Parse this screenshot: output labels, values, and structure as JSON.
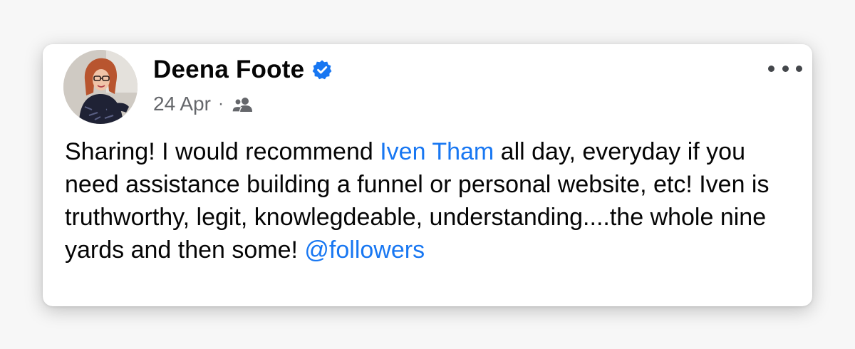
{
  "post": {
    "author_name": "Deena Foote",
    "date": "24 Apr",
    "separator": "·",
    "audience_icon": "friends-icon",
    "verified_icon": "verified-badge-icon",
    "more_icon": "more-options-icon",
    "body": {
      "segment_1": "Sharing! I would recommend ",
      "mention_1": "Iven Tham",
      "segment_2": " all day, everyday if you need assistance building a funnel or personal website, etc! Iven is truthworthy, legit, knowlegdeable, understanding....the whole nine yards and then some! ",
      "mention_2": "@followers"
    }
  },
  "colors": {
    "link": "#1877f2",
    "text": "#050505",
    "secondary_text": "#65676b",
    "verified": "#1877f2"
  }
}
